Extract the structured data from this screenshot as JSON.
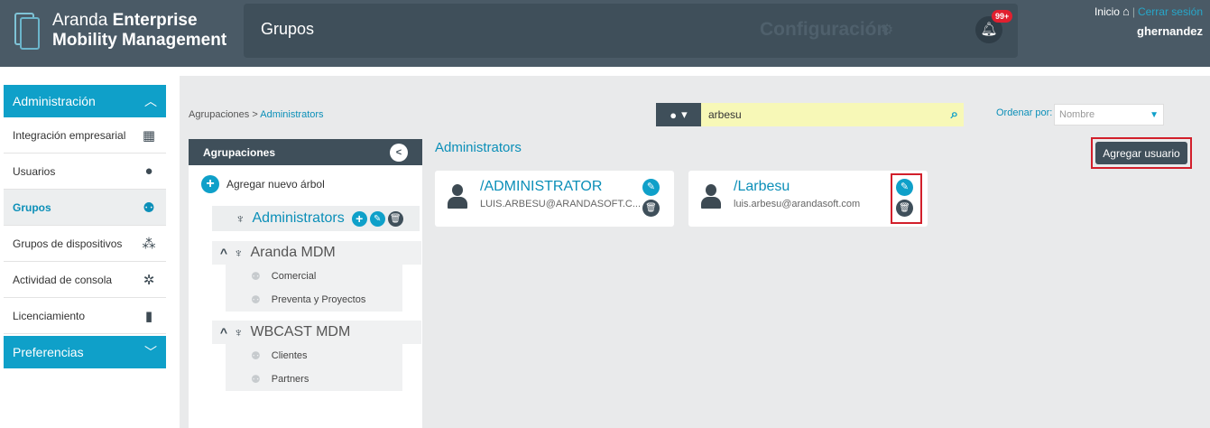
{
  "header": {
    "brand_light": "Aranda",
    "brand_bold_1": "Enterprise",
    "brand_bold_2": "Mobility Management",
    "page_title": "Grupos",
    "config_label": "Configuración",
    "notification_count": "99+",
    "home_link": "Inicio",
    "separator": "|",
    "logout_link": "Cerrar sesión",
    "username": "ghernandez"
  },
  "sidebar": {
    "section_admin": "Administración",
    "items": [
      {
        "label": "Integración empresarial",
        "icon": "building-icon"
      },
      {
        "label": "Usuarios",
        "icon": "user-icon"
      },
      {
        "label": "Grupos",
        "icon": "users-group-icon"
      },
      {
        "label": "Grupos de dispositivos",
        "icon": "device-groups-icon"
      },
      {
        "label": "Actividad de consola",
        "icon": "network-activity-icon"
      },
      {
        "label": "Licenciamiento",
        "icon": "license-book-icon"
      }
    ],
    "active_index": 2,
    "section_prefs": "Preferencias"
  },
  "breadcrumb": {
    "root": "Agrupaciones",
    "separator": ">",
    "current": "Administrators"
  },
  "search": {
    "value": "arbesu",
    "type_icon": "user-icon"
  },
  "sort": {
    "label": "Ordenar por:",
    "selected": "Nombre"
  },
  "tree": {
    "header": "Agrupaciones",
    "add_label": "Agregar nuevo árbol",
    "selected": "Administrators",
    "groups": [
      {
        "label": "Aranda MDM",
        "children": [
          "Comercial",
          "Preventa y Proyectos"
        ]
      },
      {
        "label": "WBCAST MDM",
        "children": [
          "Clientes",
          "Partners"
        ]
      }
    ]
  },
  "content": {
    "title": "Administrators",
    "add_user_label": "Agregar usuario",
    "users": [
      {
        "name": "/ADMINISTRATOR",
        "email": "LUIS.ARBESU@ARANDASOFT.C..."
      },
      {
        "name": "/Larbesu",
        "email": "luis.arbesu@arandasoft.com"
      }
    ]
  },
  "colors": {
    "header_bg": "#4a5a66",
    "accent": "#0fa0c9",
    "highlight": "#d21f2b",
    "search_bg": "#f7f8b7"
  }
}
